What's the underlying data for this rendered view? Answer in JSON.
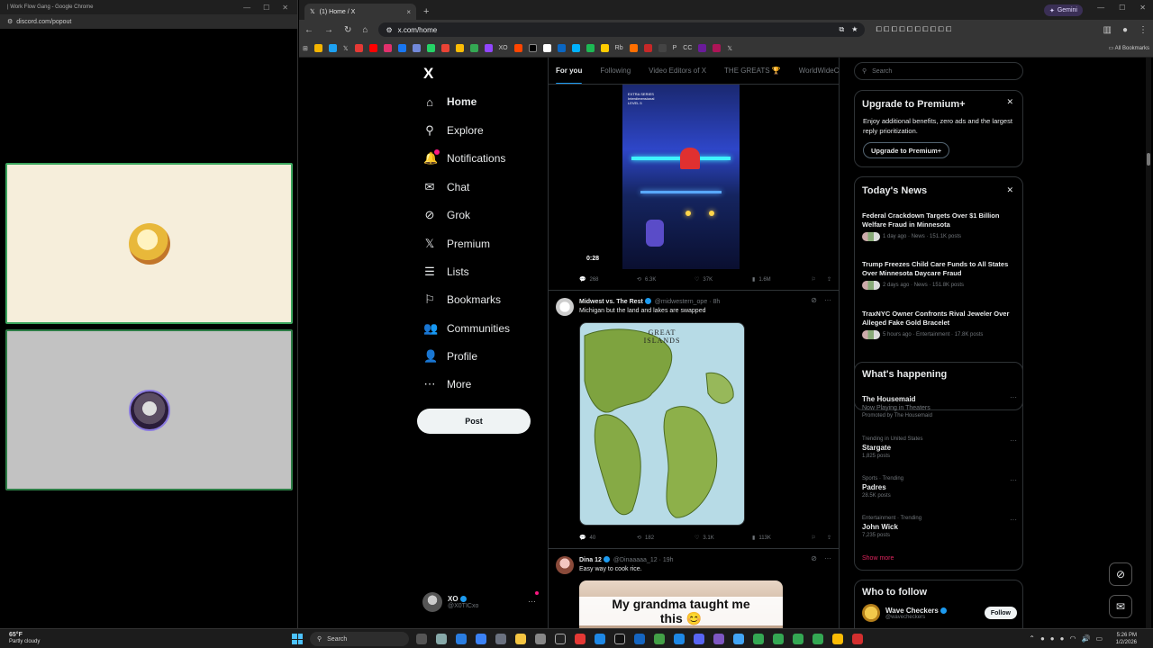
{
  "discord_window": {
    "title": "| Work Flow Gang - Google Chrome",
    "url": "discord.com/popout",
    "minimize": "—",
    "maximize": "☐",
    "close": "✕"
  },
  "chrome": {
    "tab_title": "(1) Home / X",
    "tab_close": "×",
    "new_tab": "+",
    "gemini_label": "Gemini",
    "url": "x.com/home",
    "all_bookmarks": "All Bookmarks",
    "bookmark_labels": [
      "XO",
      "P",
      "CC",
      "Rb"
    ]
  },
  "x": {
    "logo": "X",
    "nav": [
      {
        "label": "Home",
        "icon": "home-icon",
        "glyph": "⌂"
      },
      {
        "label": "Explore",
        "icon": "search-icon",
        "glyph": "⚲"
      },
      {
        "label": "Notifications",
        "icon": "bell-icon",
        "glyph": "🔔"
      },
      {
        "label": "Chat",
        "icon": "mail-icon",
        "glyph": "✉"
      },
      {
        "label": "Grok",
        "icon": "grok-icon",
        "glyph": "⊘"
      },
      {
        "label": "Premium",
        "icon": "x-premium-icon",
        "glyph": "𝕏"
      },
      {
        "label": "Lists",
        "icon": "list-icon",
        "glyph": "☰"
      },
      {
        "label": "Bookmarks",
        "icon": "bookmark-icon",
        "glyph": "⚐"
      },
      {
        "label": "Communities",
        "icon": "people-icon",
        "glyph": "👥"
      },
      {
        "label": "Profile",
        "icon": "person-icon",
        "glyph": "👤"
      },
      {
        "label": "More",
        "icon": "more-circle-icon",
        "glyph": "⋯"
      }
    ],
    "post_button": "Post",
    "account": {
      "name": "XO",
      "handle": "@X0TICxo",
      "more": "···"
    },
    "feed_tabs": [
      "For you",
      "Following",
      "Video Editors of X",
      "THE GREATS 🏆",
      "WorldWideCa"
    ],
    "video_post": {
      "duration": "0:28",
      "caption_lines": [
        "EXTRA SERIES",
        "Interdimensional",
        "LEVEL 5"
      ],
      "replies": "268",
      "reposts": "6.3K",
      "likes": "37K",
      "views": "1.6M"
    },
    "map_post": {
      "author": "Midwest vs. The Rest",
      "handle": "@midwestern_ope",
      "time": "8h",
      "text": "Michigan but the land and lakes are swapped",
      "image_label": "GREAT\nISLANDS",
      "replies": "40",
      "reposts": "182",
      "likes": "3.1K",
      "views": "113K"
    },
    "rice_post": {
      "author": "Dina 12",
      "handle": "@Dinaaaaa_12",
      "time": "19h",
      "text": "Easy way to cook rice.",
      "overlay": "My grandma taught me\nthis 😊"
    },
    "search_placeholder": "Search",
    "premium_card": {
      "title": "Upgrade to Premium+",
      "desc": "Enjoy additional benefits, zero ads and the largest reply prioritization.",
      "button": "Upgrade to Premium+",
      "close": "✕"
    },
    "news_card": {
      "title": "Today's News",
      "close": "✕",
      "items": [
        {
          "title": "Federal Crackdown Targets Over $1 Billion Welfare Fraud in Minnesota",
          "meta": "1 day ago · News · 151.1K posts"
        },
        {
          "title": "Trump Freezes Child Care Funds to All States Over Minnesota Daycare Fraud",
          "meta": "2 days ago · News · 151.8K posts"
        },
        {
          "title": "TraxNYC Owner Confronts Rival Jeweler Over Alleged Fake Gold Bracelet",
          "meta": "5 hours ago · Entertainment · 17.8K posts"
        }
      ]
    },
    "happening_card": {
      "title": "What's happening",
      "items": [
        {
          "context": "",
          "name": "The Housemaid",
          "sub": "Now Playing in Theaters",
          "count": "Promoted by The Housemaid"
        },
        {
          "context": "Trending in United States",
          "name": "Stargate",
          "sub": "",
          "count": "1,825 posts"
        },
        {
          "context": "Sports · Trending",
          "name": "Padres",
          "sub": "",
          "count": "28.5K posts"
        },
        {
          "context": "Entertainment · Trending",
          "name": "John Wick",
          "sub": "",
          "count": "7,235 posts"
        }
      ],
      "show_more": "Show more"
    },
    "follow_card": {
      "title": "Who to follow",
      "account_name": "Wave Checkers",
      "handle": "@wavecheckers",
      "button": "Follow"
    }
  },
  "taskbar": {
    "temp": "65°F",
    "weather": "Partly cloudy",
    "search": "Search",
    "time": "5:26 PM",
    "date": "1/2/2026"
  },
  "colors": {
    "accent": "#1d9bf0",
    "notif": "#f91880",
    "tile_border": "#3ba55d"
  }
}
